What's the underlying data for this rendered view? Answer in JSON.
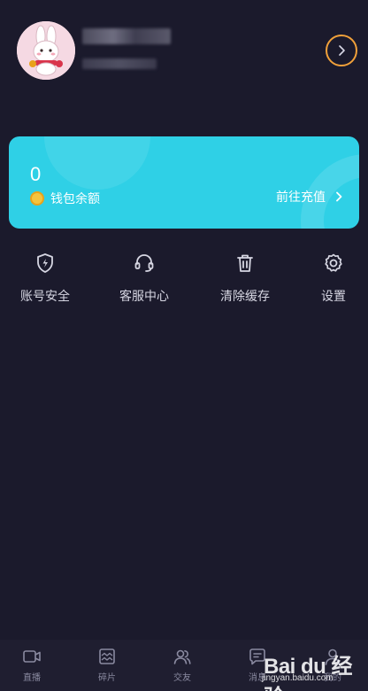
{
  "wallet": {
    "amount": "0",
    "label": "钱包余额",
    "recharge_label": "前往充值"
  },
  "menu": {
    "items": [
      {
        "label": "账号安全",
        "icon": "shield-bolt-icon"
      },
      {
        "label": "客服中心",
        "icon": "headset-icon"
      },
      {
        "label": "清除缓存",
        "icon": "trash-icon"
      },
      {
        "label": "设置",
        "icon": "gear-icon"
      }
    ]
  },
  "tabs": {
    "items": [
      {
        "label": "直播",
        "icon": "video-camera-icon"
      },
      {
        "label": "碎片",
        "icon": "fragment-icon"
      },
      {
        "label": "交友",
        "icon": "friends-icon"
      },
      {
        "label": "消息",
        "icon": "message-icon"
      },
      {
        "label": "我的",
        "icon": "user-icon"
      }
    ]
  },
  "watermark": {
    "brand": "Bai du 经验",
    "url": "jingyan.baidu.com"
  },
  "colors": {
    "background": "#1b1a2c",
    "wallet_card": "#2fd0e6",
    "profile_arrow_ring": "#f0a03a",
    "coin": "#f4c43e"
  }
}
